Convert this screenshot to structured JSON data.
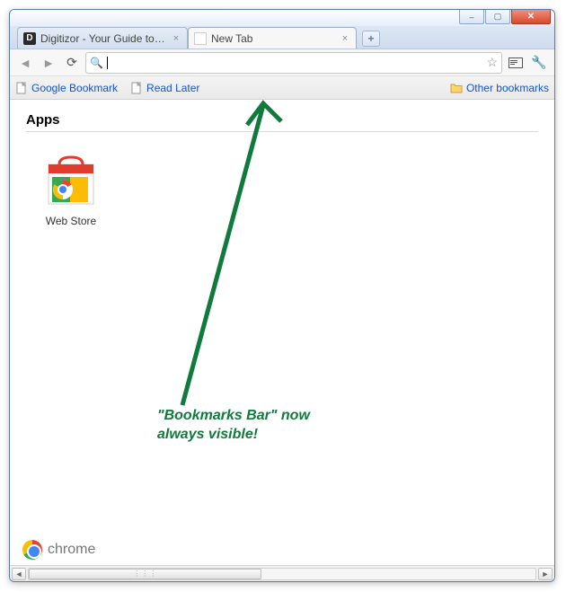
{
  "window": {
    "buttons": {
      "minimize": "–",
      "maximize": "▢",
      "close": "✕"
    }
  },
  "tabs": [
    {
      "title": "Digitizor - Your Guide to ...",
      "favicon": "D",
      "active": false
    },
    {
      "title": "New Tab",
      "favicon": "",
      "active": true
    }
  ],
  "newtab_button_label": "+",
  "toolbar": {
    "back": "◄",
    "forward": "►",
    "reload": "⟳",
    "search_icon": "🔍",
    "address_value": "",
    "star": "☆",
    "page_icon": "▭",
    "wrench": "🔧"
  },
  "bookmarks_bar": {
    "items": [
      {
        "label": "Google Bookmark"
      },
      {
        "label": "Read Later"
      }
    ],
    "other_label": "Other bookmarks"
  },
  "content": {
    "apps_heading": "Apps",
    "apps": [
      {
        "label": "Web Store"
      }
    ],
    "brand_text": "chrome"
  },
  "annotation": {
    "line1": "\"Bookmarks Bar\" now",
    "line2": "always visible!",
    "color": "#0f7a3c"
  },
  "scrollbar": {
    "left_arrow": "◄",
    "right_arrow": "►",
    "grip": "⋮⋮⋮"
  }
}
